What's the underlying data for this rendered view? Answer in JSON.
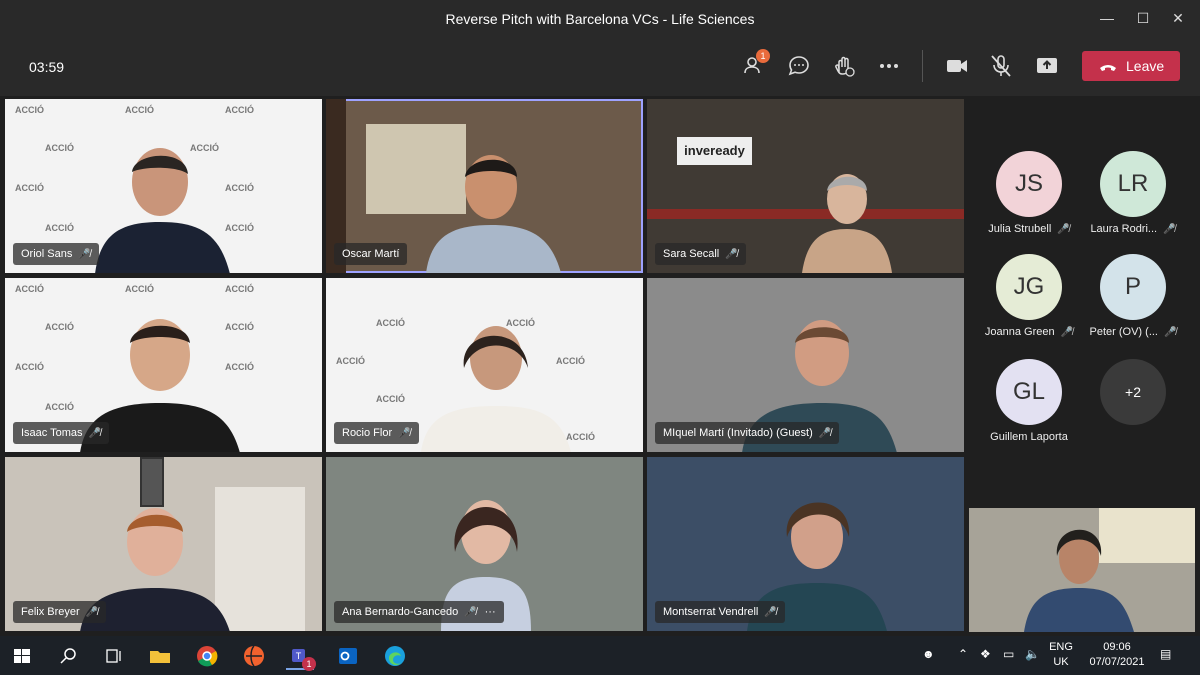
{
  "window": {
    "title": "Reverse Pitch with Barcelona VCs - Life Sciences"
  },
  "toolbar": {
    "timer": "03:59",
    "participants_badge": "1",
    "leave_label": "Leave"
  },
  "tiles": [
    {
      "name": "Oriol Sans"
    },
    {
      "name": "Oscar Martí"
    },
    {
      "name": "Sara Secall"
    },
    {
      "name": "Isaac Tomas"
    },
    {
      "name": "Rocio Flor"
    },
    {
      "name": "MIquel Martí (Invitado) (Guest)"
    },
    {
      "name": "Felix Breyer"
    },
    {
      "name": "Ana Bernardo-Gancedo",
      "more": "···"
    },
    {
      "name": "Montserrat Vendrell"
    }
  ],
  "backgrounds": {
    "accio_text": "ACCIÓ",
    "inveready_text": "inveready"
  },
  "panel": {
    "avatars": [
      {
        "initials": "JS",
        "name": "Julia Strubell",
        "color": "#f2d3d8"
      },
      {
        "initials": "LR",
        "name": "Laura Rodri...",
        "color": "#cfe8d8"
      },
      {
        "initials": "JG",
        "name": "Joanna Green",
        "color": "#e5ecd6"
      },
      {
        "initials": "P",
        "name": "Peter (OV) (...",
        "color": "#d3e3ea"
      },
      {
        "initials": "GL",
        "name": "Guillem Laporta",
        "color": "#e3e1f2"
      }
    ],
    "overflow": "+2"
  },
  "taskbar": {
    "lang": "ENG",
    "region": "UK",
    "time": "09:06",
    "date": "07/07/2021",
    "teams_badge": "1"
  }
}
